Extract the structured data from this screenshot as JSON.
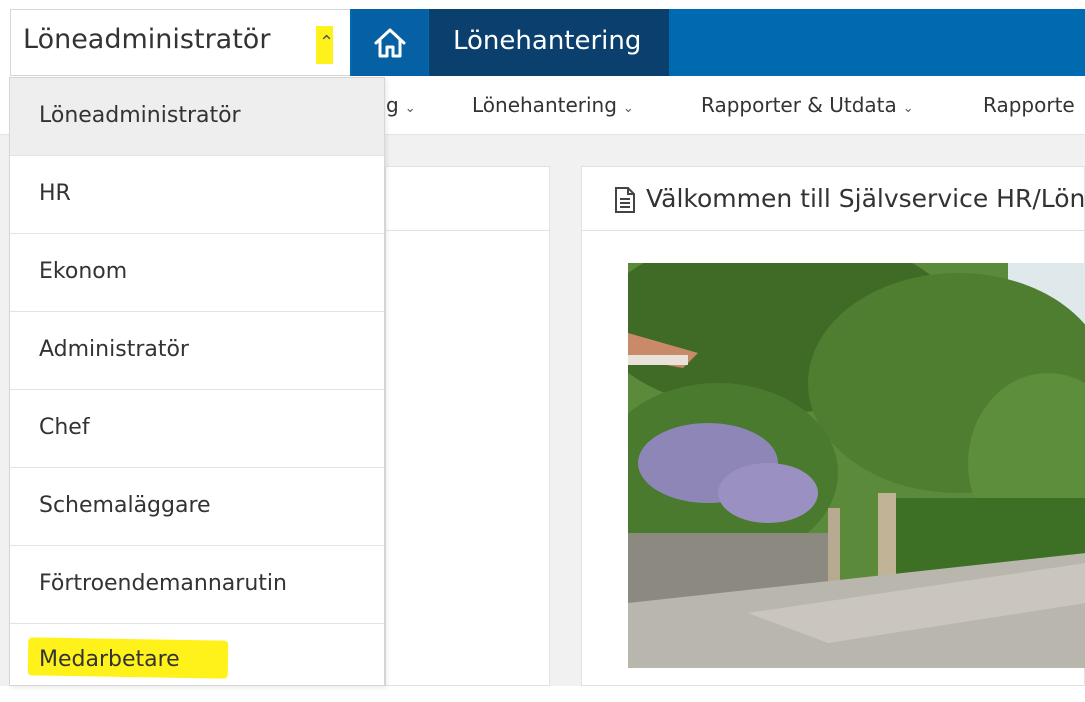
{
  "header": {
    "role_label": "Löneadministratör",
    "app_tab_label": "Lönehantering"
  },
  "nav": {
    "items": [
      {
        "label": "g"
      },
      {
        "label": "Lönehantering"
      },
      {
        "label": "Rapporter & Utdata"
      },
      {
        "label": "Rapporte"
      }
    ]
  },
  "dropdown": {
    "options": [
      {
        "label": "Löneadministratör"
      },
      {
        "label": "HR"
      },
      {
        "label": "Ekonom"
      },
      {
        "label": "Administratör"
      },
      {
        "label": "Chef"
      },
      {
        "label": "Schemaläggare"
      },
      {
        "label": "Förtroendemannarutin"
      },
      {
        "label": "Medarbetare"
      }
    ]
  },
  "main": {
    "title": "Välkommen till Självservice HR/Lön"
  },
  "colors": {
    "primary": "#006ab0",
    "active_tab": "#0a3f6e",
    "home_tile": "#0561a3",
    "highlight": "#fff21a"
  },
  "icons": [
    "home-icon",
    "chevron-up-icon",
    "chevron-down-icon",
    "document-icon"
  ]
}
